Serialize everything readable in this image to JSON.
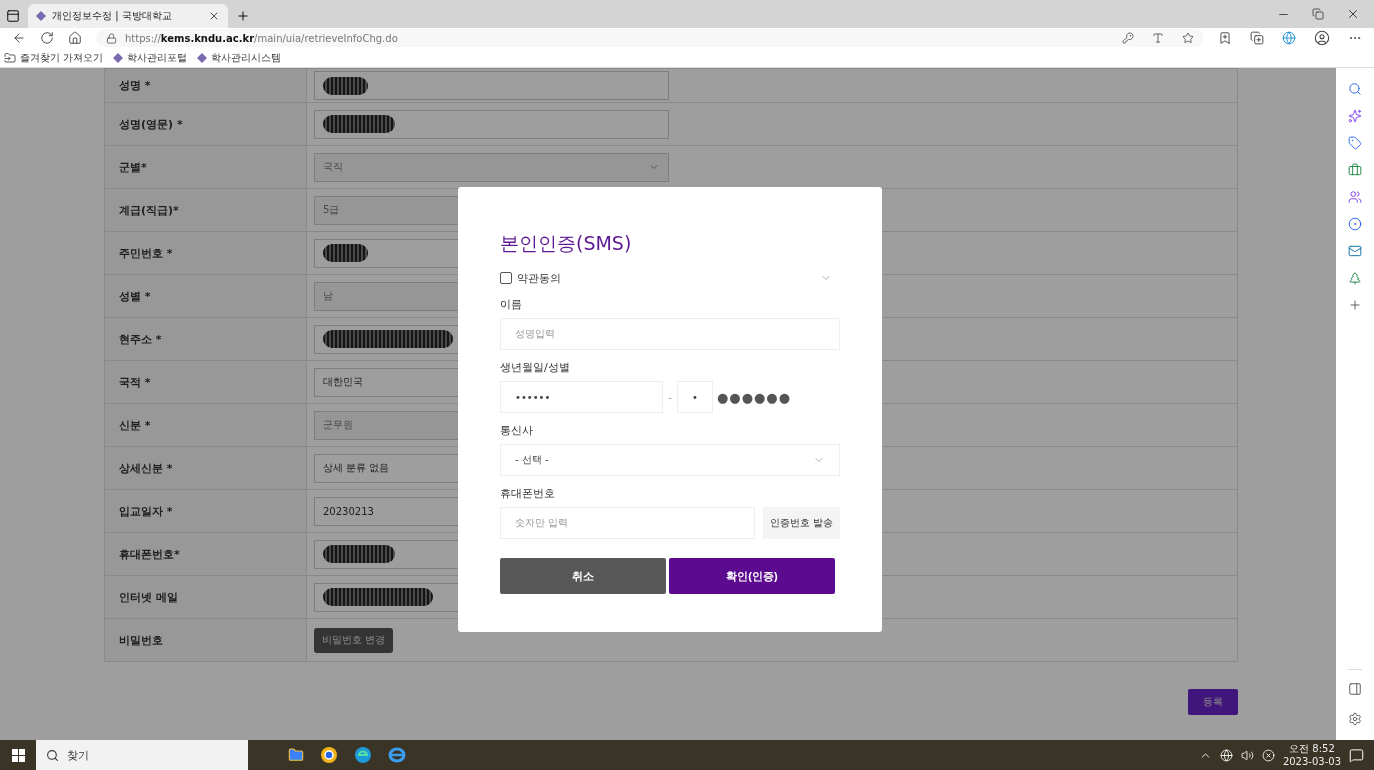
{
  "browser": {
    "tabs": [
      {
        "title": "개인정보수정 | 국방대학교",
        "selected": true
      }
    ],
    "url": "https://**kems.kndu.ac.kr**/main/uia/retrieveInfoChg.do",
    "bookmarks": [
      {
        "label": "즐겨찾기 가져오기",
        "kind": "import"
      },
      {
        "label": "학사관리포털",
        "kind": "site"
      },
      {
        "label": "학사관리시스템",
        "kind": "site"
      }
    ]
  },
  "form": {
    "rows": [
      {
        "label": "성명 *",
        "field": {
          "kind": "redacted"
        }
      },
      {
        "label": "성명(영문) *",
        "field": {
          "kind": "redacted"
        }
      },
      {
        "label": "군별*",
        "field": {
          "kind": "select",
          "value": "국직",
          "disabled": true
        }
      },
      {
        "label": "계급(직급)*",
        "field": {
          "kind": "text",
          "value": "5급",
          "disabled": true
        }
      },
      {
        "label": "주민번호 *",
        "field": {
          "kind": "redacted"
        }
      },
      {
        "label": "성별 *",
        "field": {
          "kind": "text",
          "value": "남",
          "disabled": true
        }
      },
      {
        "label": "현주소 *",
        "field": {
          "kind": "redacted"
        }
      },
      {
        "label": "국적 *",
        "field": {
          "kind": "text",
          "value": "대한민국",
          "disabled": false
        }
      },
      {
        "label": "신분 *",
        "field": {
          "kind": "text",
          "value": "군무원",
          "disabled": true
        }
      },
      {
        "label": "상세신분 *",
        "field": {
          "kind": "text",
          "value": "상세 분류 없음",
          "disabled": false
        }
      },
      {
        "label": "입교일자 *",
        "field": {
          "kind": "text",
          "value": "20230213",
          "disabled": false
        }
      },
      {
        "label": "휴대폰번호*",
        "field": {
          "kind": "redacted"
        }
      },
      {
        "label": "인터넷 메일",
        "field": {
          "kind": "redacted"
        }
      },
      {
        "label": "비밀번호",
        "field": {
          "kind": "button",
          "value": "비밀번호 변경"
        }
      }
    ],
    "submit": "등록"
  },
  "modal": {
    "title": "본인인증(SMS)",
    "agree": {
      "label": "약관동의",
      "checked": false
    },
    "name": {
      "label": "이름",
      "placeholder": "성명입력"
    },
    "birth": {
      "label": "생년월일/성별",
      "value": "••••••",
      "separator": "-",
      "gender": "•",
      "masked": "●●●●●●"
    },
    "carrier": {
      "label": "통신사",
      "value": "- 선택 -"
    },
    "phone": {
      "label": "휴대폰번호",
      "placeholder": "숫자만 입력",
      "send": "인증번호 발송"
    },
    "buttons": {
      "cancel": "취소",
      "confirm": "확인(인증)"
    }
  },
  "taskbar": {
    "search": "찾기",
    "time": "오전 8:52",
    "date": "2023-03-03"
  }
}
